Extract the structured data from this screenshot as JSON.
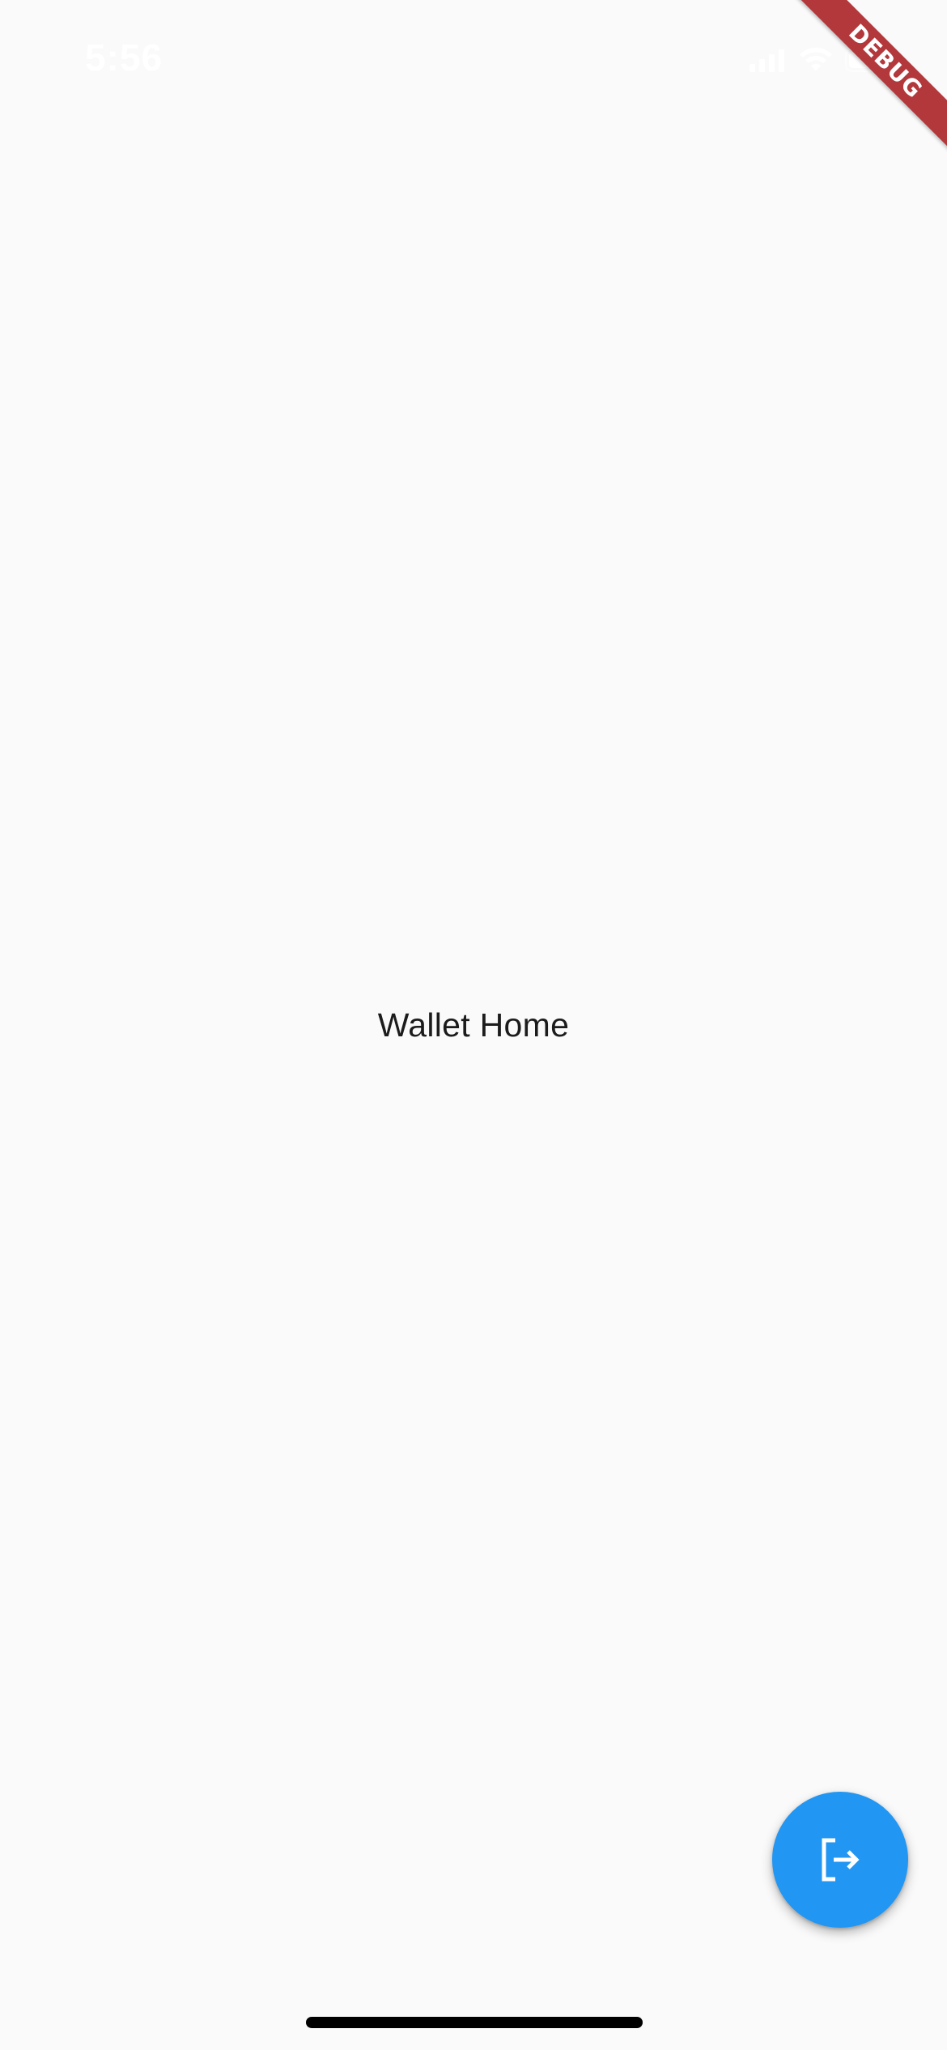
{
  "status_bar": {
    "time": "5:56",
    "icons": [
      "signal-icon",
      "wifi-icon",
      "battery-icon"
    ]
  },
  "debug_banner": {
    "label": "DEBUG",
    "color": "#b3383c"
  },
  "main": {
    "title": "Wallet Home"
  },
  "fab": {
    "icon": "logout-icon",
    "color": "#2196f3"
  },
  "colors": {
    "background": "#fafafa",
    "text": "#1c1c1c",
    "accent": "#2196f3"
  }
}
